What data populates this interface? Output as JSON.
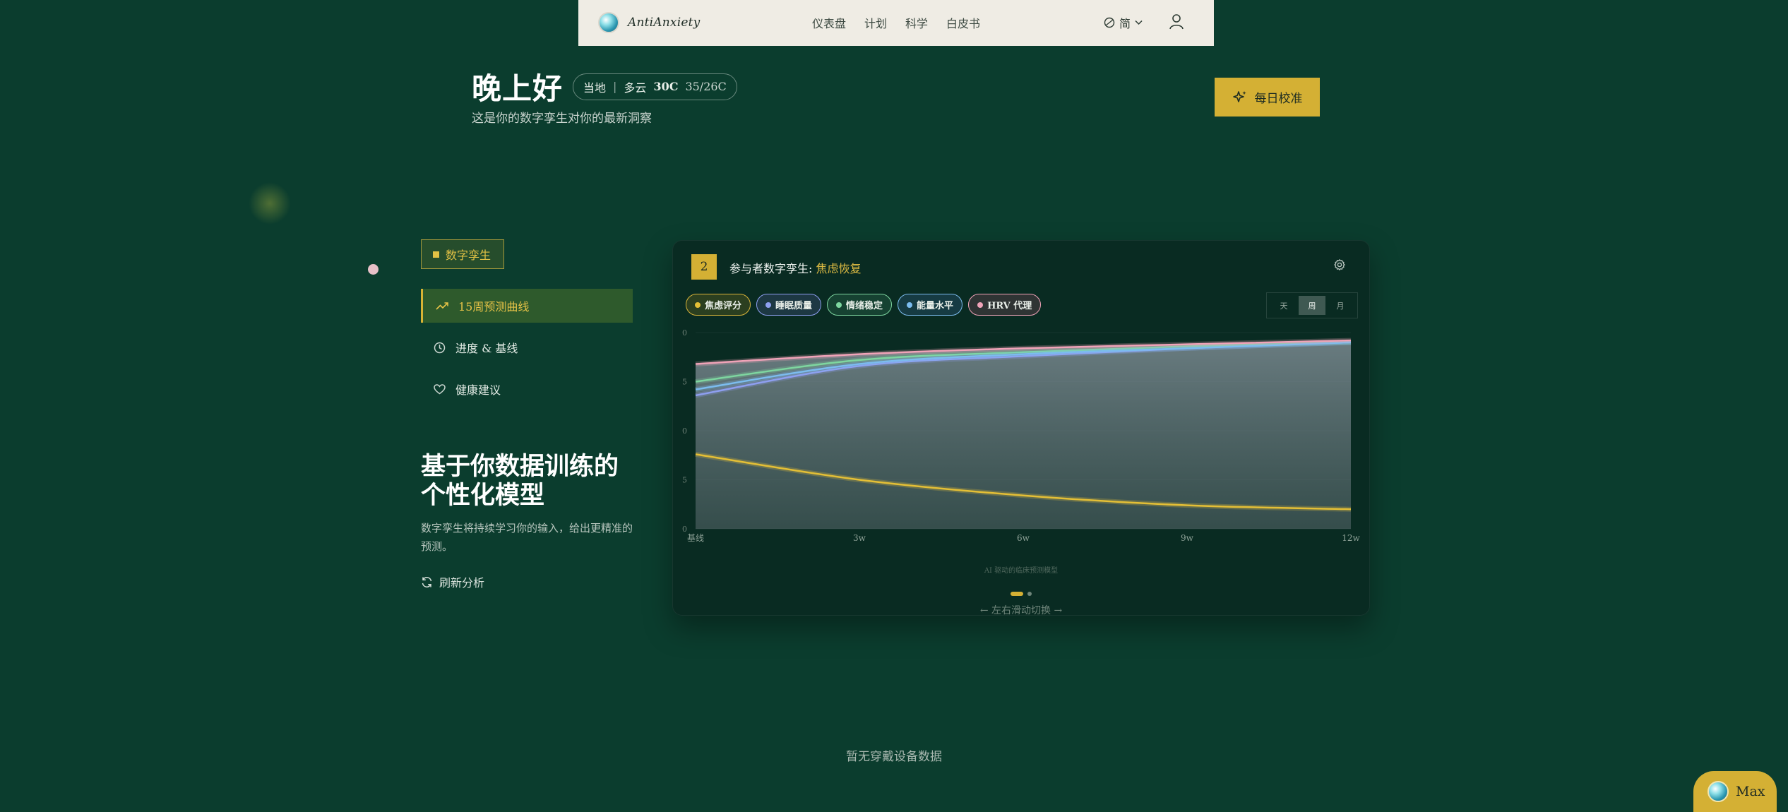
{
  "nav": {
    "logo_text": "AntiAnxiety",
    "links": [
      "仪表盘",
      "计划",
      "科学",
      "白皮书"
    ],
    "lang": "简"
  },
  "greeting": {
    "title": "晚上好",
    "location": "当地",
    "weather": "多云",
    "temp": "30C",
    "range": "35/26C",
    "subtitle": "这是你的数字孪生对你的最新洞察"
  },
  "calibrate_label": "每日校准",
  "sidebar": {
    "badge": "数字孪生",
    "items": [
      {
        "label": "15周预测曲线",
        "icon": "trending-up-icon",
        "active": true
      },
      {
        "label": "进度 & 基线",
        "icon": "clock-icon",
        "active": false
      },
      {
        "label": "健康建议",
        "icon": "heart-icon",
        "active": false
      }
    ],
    "model_title_line1": "基于你数据训练的",
    "model_title_line2": "个性化模型",
    "model_desc": "数字孪生将持续学习你的输入，给出更精准的预测。",
    "refresh_label": "刷新分析"
  },
  "card": {
    "number": "2",
    "title_prefix": "参与者数字孪生:",
    "title_focus": "焦虑恢复",
    "legend": [
      {
        "label": "焦虑评分",
        "color": "#e4bf36"
      },
      {
        "label": "睡眠质量",
        "color": "#8e9ff0"
      },
      {
        "label": "情绪稳定",
        "color": "#7ed6a0"
      },
      {
        "label": "能量水平",
        "color": "#7cbcef"
      },
      {
        "label": "HRV 代理",
        "color": "#f0a3b8"
      }
    ],
    "periods": [
      "天",
      "周",
      "月"
    ],
    "active_period": "周",
    "caption": "AI 驱动的临床预测模型",
    "swipe_hint": "← 左右滑动切换 →"
  },
  "chart_data": {
    "type": "line",
    "x": [
      "基线",
      "3w",
      "6w",
      "9w",
      "12w"
    ],
    "yticks": [
      "0",
      "5",
      "0",
      "5",
      "0"
    ],
    "ylim": [
      0,
      10
    ],
    "series": [
      {
        "name": "焦虑评分",
        "color": "#e4bf36",
        "values": [
          3.8,
          2.5,
          1.7,
          1.2,
          1.0
        ]
      },
      {
        "name": "睡眠质量",
        "color": "#8e9ff0",
        "values": [
          6.8,
          8.3,
          8.8,
          9.2,
          9.5
        ]
      },
      {
        "name": "情绪稳定",
        "color": "#7ed6a0",
        "values": [
          7.5,
          8.6,
          9.0,
          9.3,
          9.5
        ]
      },
      {
        "name": "能量水平",
        "color": "#7cbcef",
        "values": [
          7.1,
          8.4,
          8.9,
          9.2,
          9.5
        ]
      },
      {
        "name": "HRV 代理",
        "color": "#f0a3b8",
        "values": [
          8.4,
          8.9,
          9.2,
          9.4,
          9.6
        ]
      }
    ]
  },
  "footer": {
    "no_data": "暂无穿戴设备数据",
    "assistant_label": "Max"
  }
}
